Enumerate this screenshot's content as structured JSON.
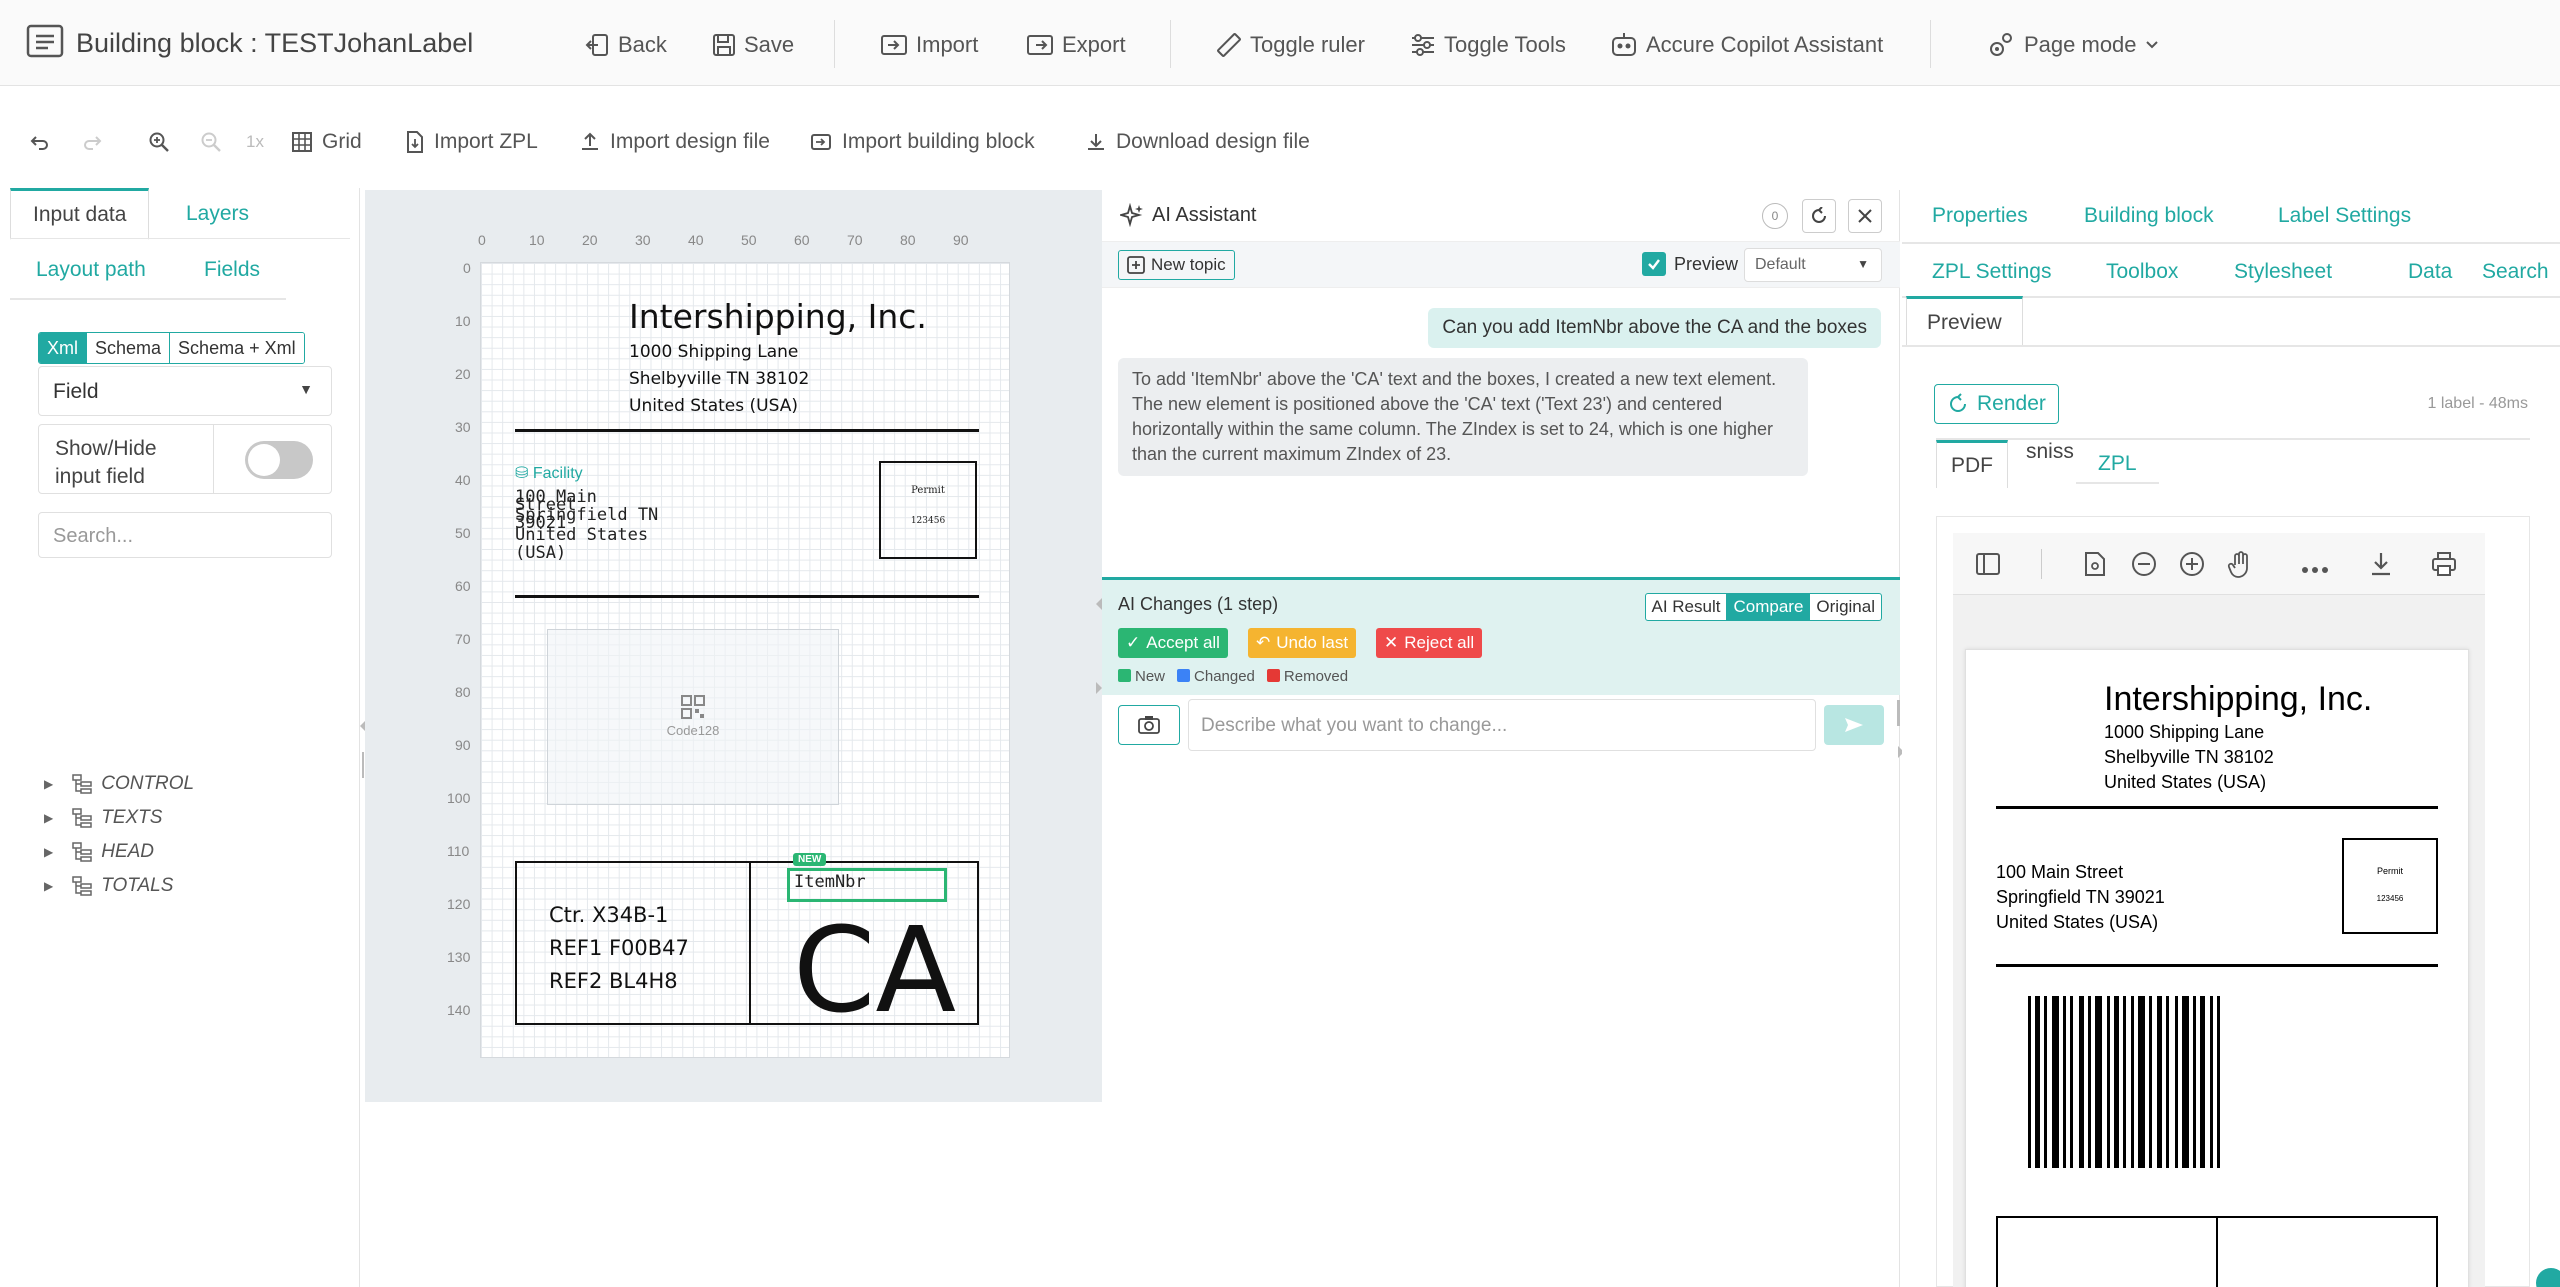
{
  "header": {
    "title": "Building block : TESTJohanLabel",
    "back": "Back",
    "save": "Save",
    "import": "Import",
    "export": "Export",
    "toggle_ruler": "Toggle ruler",
    "toggle_tools": "Toggle Tools",
    "copilot": "Accure Copilot Assistant",
    "page_mode": "Page mode"
  },
  "toolbar": {
    "zoom_level": "1x",
    "grid": "Grid",
    "import_zpl": "Import ZPL",
    "import_design": "Import design file",
    "import_block": "Import building block",
    "download_design": "Download design file"
  },
  "left": {
    "tabs": [
      "Input data",
      "Layers",
      "Layout path",
      "Fields"
    ],
    "formats": [
      "Xml",
      "Schema",
      "Schema + Xml"
    ],
    "field_select": "Field",
    "toggle_label": "Show/Hide input field",
    "search_placeholder": "Search...",
    "tree": [
      "CONTROL",
      "TEXTS",
      "HEAD",
      "TOTALS"
    ]
  },
  "ruler": {
    "x": [
      "0",
      "10",
      "20",
      "30",
      "40",
      "50",
      "60",
      "70",
      "80",
      "90"
    ],
    "y": [
      "0",
      "10",
      "20",
      "30",
      "40",
      "50",
      "60",
      "70",
      "80",
      "90",
      "100",
      "110",
      "120",
      "130",
      "140"
    ]
  },
  "label": {
    "company": "Intershipping, Inc.",
    "addr1": "1000 Shipping Lane",
    "addr2": "Shelbyville TN 38102",
    "addr3": "United States (USA)",
    "facility": "Facility",
    "to1": "100 Main",
    "to1b": "Street",
    "to2": "Springfield TN",
    "to2b": "39021",
    "to3": "United States",
    "to3b": "(USA)",
    "permit": "Permit",
    "permit_no": "123456",
    "barcode": "Code128",
    "ctr1": "Ctr. X34B-1",
    "ctr2": "REF1 F00B47",
    "ctr3": "REF2 BL4H8",
    "ca": "CA",
    "new_badge": "NEW",
    "itemnbr": "ItemNbr"
  },
  "ai": {
    "title": "AI Assistant",
    "new_topic": "New topic",
    "preview_label": "Preview",
    "preview_select": "Default",
    "user_msg": "Can you add ItemNbr above the CA and the boxes",
    "ai_msg": "To add 'ItemNbr' above the 'CA' text and the boxes, I created a new text element. The new element is positioned above the 'CA' text ('Text 23') and centered horizontally within the same column. The ZIndex is set to 24, which is one higher than the current maximum ZIndex of 23.",
    "changes_title": "AI Changes (1 step)",
    "compare_tabs": [
      "AI Result",
      "Compare",
      "Original"
    ],
    "accept_all": "Accept all",
    "undo_last": "Undo last",
    "reject_all": "Reject all",
    "legend": [
      "New",
      "Changed",
      "Removed"
    ],
    "describe_placeholder": "Describe what you want to change...",
    "counter": "0"
  },
  "right": {
    "tabs_row1": [
      "Properties",
      "Building block",
      "Label Settings"
    ],
    "tabs_row2": [
      "ZPL Settings",
      "Toolbox",
      "Stylesheet",
      "Data",
      "Search"
    ],
    "preview_tab": "Preview",
    "render": "Render",
    "render_info": "1 label - 48ms",
    "fmt_tabs": [
      "PDF",
      "ZPL"
    ],
    "overlap_text": "sniss",
    "pdf": {
      "company": "Intershipping, Inc.",
      "addr1": "1000 Shipping Lane",
      "addr2": "Shelbyville TN 38102",
      "addr3": "United States (USA)",
      "to1": "100 Main Street",
      "to2": "Springfield TN 39021",
      "to3": "United States (USA)",
      "permit": "Permit",
      "permit_no": "123456"
    }
  },
  "colors": {
    "accent": "#21a9a2",
    "new": "#2bb673",
    "changed": "#3b82f6",
    "removed": "#e53935",
    "undo": "#f5a623",
    "reject": "#ef4a4a"
  }
}
